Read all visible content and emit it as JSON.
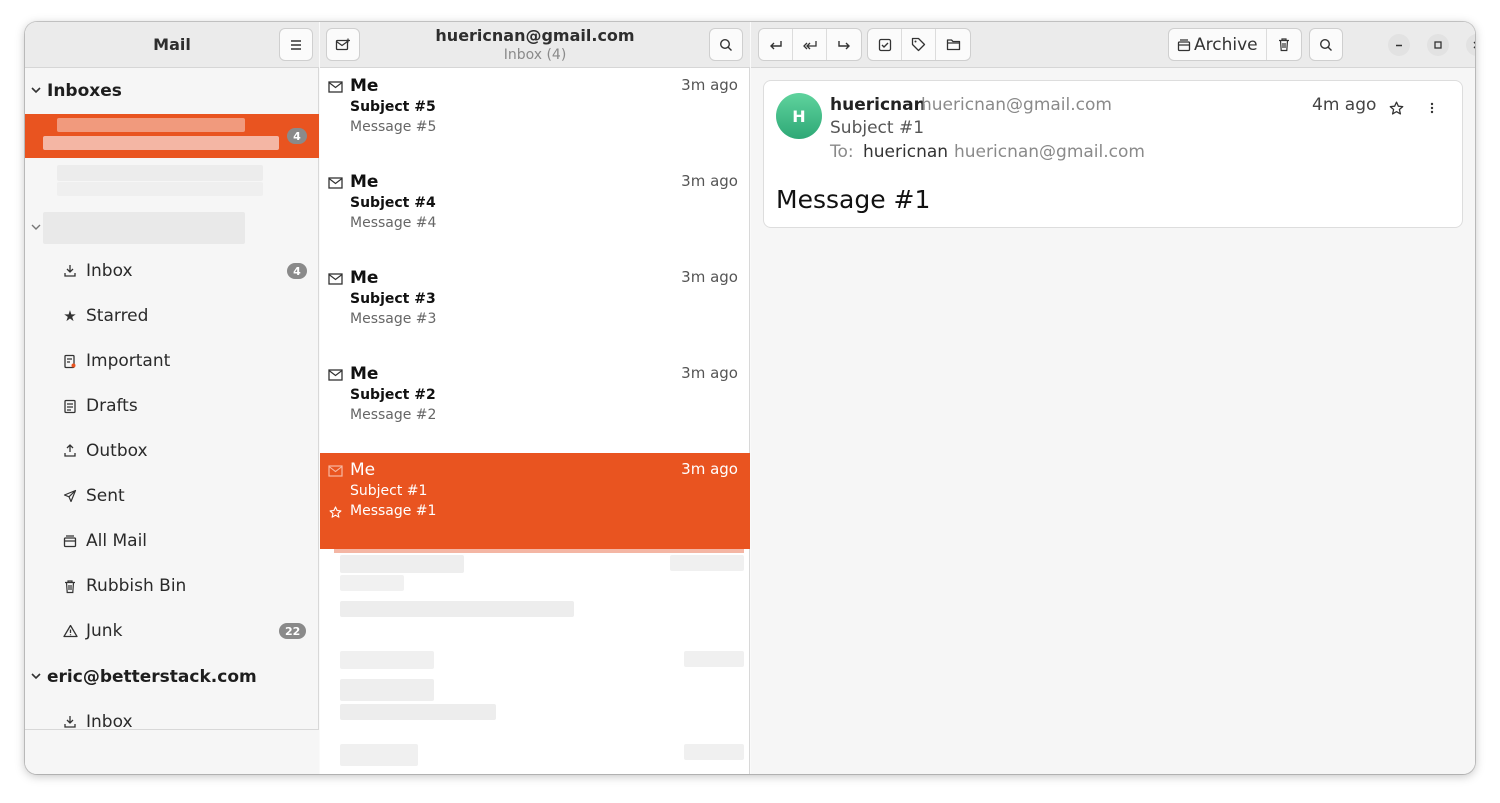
{
  "sidebar": {
    "title": "Mail",
    "menu_icon": "hamburger-menu-icon",
    "inboxes_label": "Inboxes",
    "selected_account_badge": "4",
    "folders": [
      {
        "label": "Inbox",
        "icon": "inbox-tray-icon",
        "badge": "4"
      },
      {
        "label": "Starred",
        "icon": "star-icon",
        "badge": ""
      },
      {
        "label": "Important",
        "icon": "important-icon",
        "badge": ""
      },
      {
        "label": "Drafts",
        "icon": "drafts-icon",
        "badge": ""
      },
      {
        "label": "Outbox",
        "icon": "outbox-icon",
        "badge": ""
      },
      {
        "label": "Sent",
        "icon": "sent-icon",
        "badge": ""
      },
      {
        "label": "All Mail",
        "icon": "all-mail-icon",
        "badge": ""
      },
      {
        "label": "Rubbish Bin",
        "icon": "trash-icon",
        "badge": ""
      },
      {
        "label": "Junk",
        "icon": "junk-icon",
        "badge": "22"
      }
    ],
    "second_account": {
      "label": "eric@betterstack.com",
      "folders": [
        {
          "label": "Inbox",
          "icon": "inbox-tray-icon"
        }
      ]
    }
  },
  "list": {
    "title": "huericnan@gmail.com",
    "subtitle": "Inbox (4)",
    "messages": [
      {
        "sender": "Me",
        "subject": "Subject #5",
        "preview": "Message #5",
        "time": "3m ago",
        "selected": false
      },
      {
        "sender": "Me",
        "subject": "Subject #4",
        "preview": "Message #4",
        "time": "3m ago",
        "selected": false
      },
      {
        "sender": "Me",
        "subject": "Subject #3",
        "preview": "Message #3",
        "time": "3m ago",
        "selected": false
      },
      {
        "sender": "Me",
        "subject": "Subject #2",
        "preview": "Message #2",
        "time": "3m ago",
        "selected": false
      },
      {
        "sender": "Me",
        "subject": "Subject #1",
        "preview": "Message #1",
        "time": "3m ago",
        "selected": true
      }
    ]
  },
  "toolbar": {
    "archive_label": "Archive",
    "buttons": [
      "reply-icon",
      "reply-all-icon",
      "forward-icon",
      "mark-read-icon",
      "tag-icon",
      "move-folder-icon",
      "archive-icon",
      "trash-icon",
      "search-icon",
      "minimize-icon",
      "maximize-icon",
      "close-icon"
    ]
  },
  "email": {
    "avatar_letter": "H",
    "from_name": "huericnan",
    "from_address": "huericnan@gmail.com",
    "time": "4m ago",
    "subject": "Subject #1",
    "to_label": "To:",
    "to_name": "huericnan",
    "to_address": "huericnan@gmail.com",
    "body": "Message #1"
  },
  "colors": {
    "accent": "#e95420",
    "avatar": "#3cb882",
    "badge": "#8a8a8a"
  }
}
